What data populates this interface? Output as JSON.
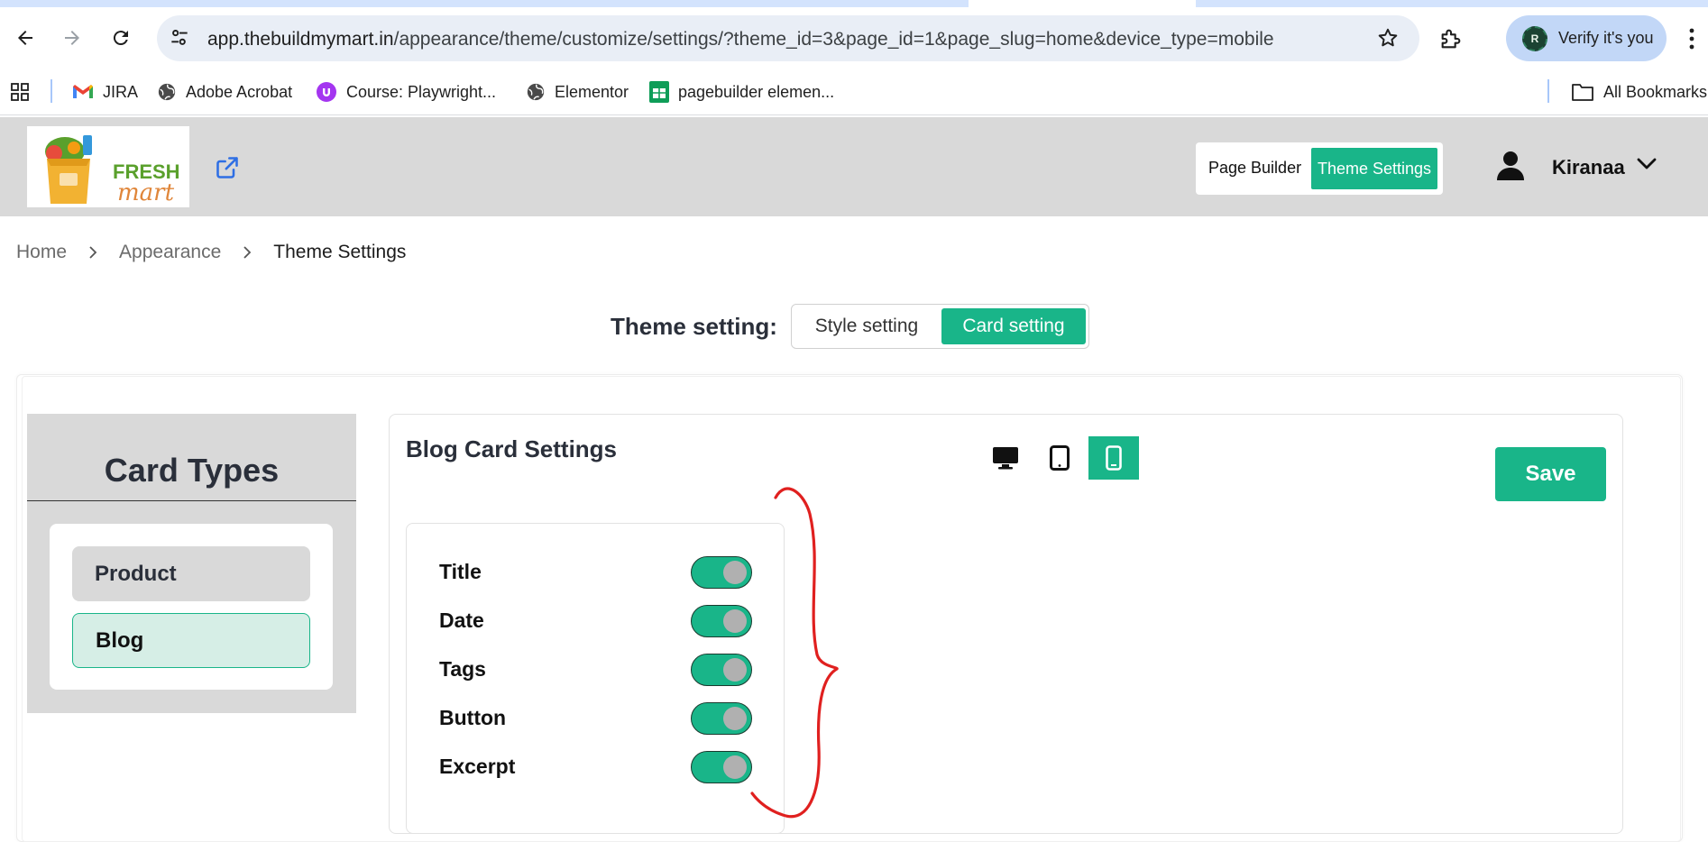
{
  "browser": {
    "url_host": "app.thebuildmymart.in",
    "url_path": "/appearance/theme/customize/settings/?theme_id=3&page_id=1&page_slug=home&device_type=mobile",
    "profile_initial": "R",
    "verify_label": "Verify it's you",
    "bookmarks": [
      {
        "label": "JIRA",
        "icon": "gmail-icon"
      },
      {
        "label": "Adobe Acrobat",
        "icon": "globe-icon"
      },
      {
        "label": "Course: Playwright...",
        "icon": "udemy-icon"
      },
      {
        "label": "Elementor",
        "icon": "globe-icon"
      },
      {
        "label": "pagebuilder elemen...",
        "icon": "sheets-icon"
      }
    ],
    "all_bookmarks_label": "All Bookmarks"
  },
  "header": {
    "logo_text_1": "FRESH",
    "logo_text_2": "mart",
    "page_builder_label": "Page Builder",
    "theme_settings_label": "Theme Settings",
    "user_name": "Kiranaa"
  },
  "breadcrumb": {
    "home": "Home",
    "appearance": "Appearance",
    "current": "Theme Settings"
  },
  "theme_setting": {
    "label": "Theme setting:",
    "style_option": "Style setting",
    "card_option": "Card setting",
    "selected": "Card setting"
  },
  "card_types": {
    "title": "Card Types",
    "items": [
      "Product",
      "Blog"
    ],
    "selected": "Blog"
  },
  "blog_settings": {
    "title": "Blog Card Settings",
    "save_label": "Save",
    "device_active": "mobile",
    "toggles": [
      {
        "label": "Title",
        "on": true
      },
      {
        "label": "Date",
        "on": true
      },
      {
        "label": "Tags",
        "on": true
      },
      {
        "label": "Button",
        "on": true
      },
      {
        "label": "Excerpt",
        "on": true
      }
    ]
  },
  "colors": {
    "accent": "#19b589",
    "header_bg": "#d9d9d9",
    "annotation": "#e0201f"
  }
}
